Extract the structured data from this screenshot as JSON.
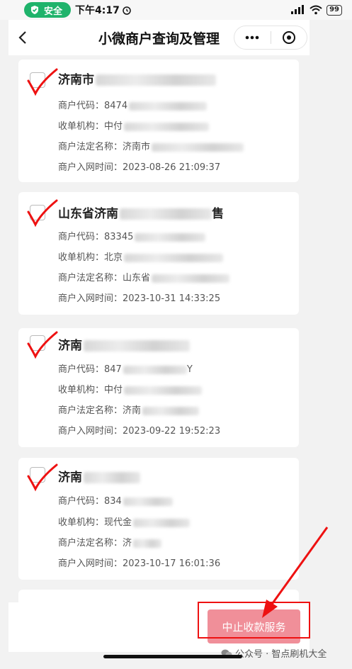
{
  "status_bar": {
    "safe_label": "安全",
    "time": "下午4:17",
    "battery": "99"
  },
  "nav": {
    "title": "小微商户查询及管理"
  },
  "merchants": [
    {
      "name": "济南市",
      "code_label": "商户代码：",
      "code": "8474",
      "org_label": "收单机构：",
      "org": "中付",
      "legal_label": "商户法定名称：",
      "legal": "济南市",
      "time_label": "商户入网时间：",
      "time": "2023-08-26 21:09:37"
    },
    {
      "name": "山东省济南",
      "name_tail": "售",
      "code_label": "商户代码：",
      "code": "83345",
      "org_label": "收单机构：",
      "org": "北京",
      "legal_label": "商户法定名称：",
      "legal": "山东省",
      "time_label": "商户入网时间：",
      "time": "2023-10-31 14:33:25"
    },
    {
      "name": "济南",
      "code_label": "商户代码：",
      "code": "847",
      "code_tail": "Y",
      "org_label": "收单机构：",
      "org": "中付",
      "legal_label": "商户法定名称：",
      "legal": "济南",
      "time_label": "商户入网时间：",
      "time": "2023-09-22 19:52:23"
    },
    {
      "name": "济南",
      "code_label": "商户代码：",
      "code": "834",
      "org_label": "收单机构：",
      "org": "现代金",
      "legal_label": "商户法定名称：",
      "legal": "济",
      "time_label": "商户入网时间：",
      "time": "2023-10-17 16:01:36"
    }
  ],
  "footer": {
    "stop_button": "中止收款服务"
  },
  "watermark": {
    "text": "公众号 · 智点刷机大全"
  },
  "colors": {
    "accent_button": "#f08f99",
    "safe_green": "#1fb36b",
    "annotation_red": "#e11111"
  }
}
